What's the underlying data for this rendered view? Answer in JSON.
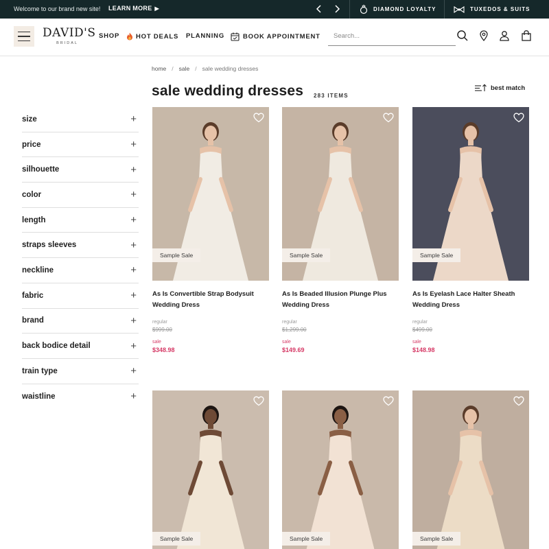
{
  "promo": {
    "welcome": "Welcome to our brand new site!",
    "learn_more": "LEARN MORE",
    "loyalty": "DIAMOND LOYALTY",
    "tuxedos": "TUXEDOS & SUITS"
  },
  "header": {
    "logo_main": "DAVID'S",
    "logo_sub": "BRIDAL",
    "nav": [
      "SHOP",
      "HOT DEALS",
      "PLANNING",
      "BOOK APPOINTMENT"
    ],
    "search_placeholder": "Search..."
  },
  "breadcrumb": [
    "home",
    "sale",
    "sale wedding dresses"
  ],
  "page": {
    "title": "sale wedding dresses",
    "count": "283 ITEMS",
    "sort_label": "best match"
  },
  "filters": [
    "size",
    "price",
    "silhouette",
    "color",
    "length",
    "straps sleeves",
    "neckline",
    "fabric",
    "brand",
    "back bodice detail",
    "train type",
    "waistline"
  ],
  "products": [
    {
      "name": "As Is Convertible Strap Bodysuit Wedding Dress",
      "badge": "Sample Sale",
      "regular_label": "regular",
      "regular": "$999.00",
      "sale_label": "sale",
      "sale": "$348.98",
      "bg": "#c7b8a8",
      "dress": "#f1ece4"
    },
    {
      "name": "As Is Beaded Illusion Plunge Plus Wedding Dress",
      "badge": "Sample Sale",
      "regular_label": "regular",
      "regular": "$1,299.00",
      "sale_label": "sale",
      "sale": "$149.69",
      "bg": "#c5b4a4",
      "dress": "#efe9df"
    },
    {
      "name": "As Is Eyelash Lace Halter Sheath Wedding Dress",
      "badge": "Sample Sale",
      "regular_label": "regular",
      "regular": "$499.00",
      "sale_label": "sale",
      "sale": "$148.98",
      "bg": "#4b4d5c",
      "dress": "#ecd8c8"
    },
    {
      "name": "",
      "badge": "Sample Sale",
      "bg": "#cbbcae",
      "dress": "#f1e6d6"
    },
    {
      "name": "",
      "badge": "Sample Sale",
      "bg": "#c9b9aa",
      "dress": "#f2e2d4"
    },
    {
      "name": "",
      "badge": "Sample Sale",
      "bg": "#bfae9f",
      "dress": "#ecdcc6"
    }
  ]
}
